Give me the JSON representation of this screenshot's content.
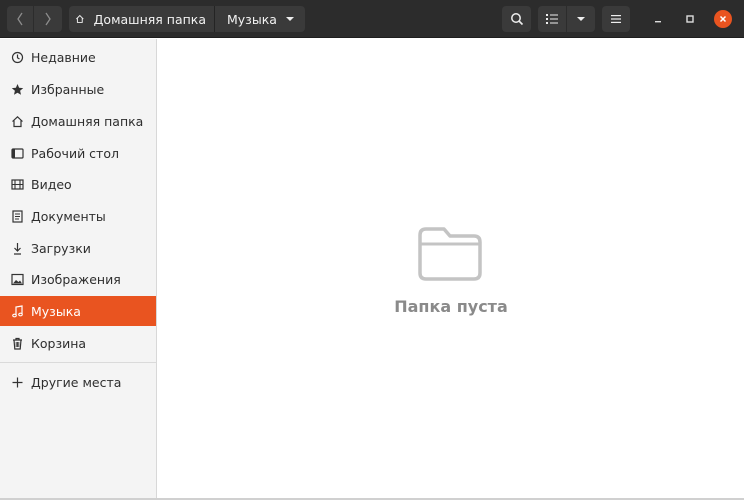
{
  "colors": {
    "accent": "#e95420",
    "headerbar": "#2c2c2c",
    "sidebar_bg": "#f4f4f4",
    "empty_text": "#8a8a8a"
  },
  "header": {
    "back_icon": "chevron-left-icon",
    "forward_icon": "chevron-right-icon",
    "path": [
      {
        "label": "Домашняя папка",
        "icon": "home-icon"
      },
      {
        "label": "Музыка",
        "icon": "dropdown-triangle-icon"
      }
    ],
    "search_icon": "search-icon",
    "view_icon": "list-view-icon",
    "view_menu_icon": "dropdown-triangle-icon",
    "menu_icon": "hamburger-menu-icon",
    "window_controls": [
      "minimize-icon",
      "maximize-icon",
      "close-icon"
    ]
  },
  "sidebar": {
    "items": [
      {
        "label": "Недавние",
        "icon": "recent-clock-icon"
      },
      {
        "label": "Избранные",
        "icon": "star-icon"
      },
      {
        "label": "Домашняя папка",
        "icon": "home-icon"
      },
      {
        "label": "Рабочий стол",
        "icon": "desktop-icon"
      },
      {
        "label": "Видео",
        "icon": "film-icon"
      },
      {
        "label": "Документы",
        "icon": "document-icon"
      },
      {
        "label": "Загрузки",
        "icon": "download-icon"
      },
      {
        "label": "Изображения",
        "icon": "image-icon"
      },
      {
        "label": "Музыка",
        "icon": "music-note-icon",
        "active": true
      },
      {
        "label": "Корзина",
        "icon": "trash-icon"
      }
    ],
    "other_places": {
      "label": "Другие места",
      "icon": "plus-icon"
    }
  },
  "main": {
    "empty_icon": "folder-icon",
    "empty_text": "Папка пуста"
  }
}
